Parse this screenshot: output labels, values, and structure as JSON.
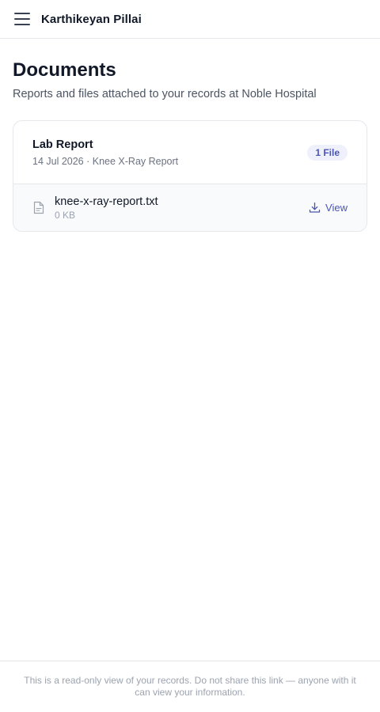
{
  "header": {
    "user_name": "Karthikeyan Pillai",
    "menu_icon": "menu-icon"
  },
  "main": {
    "title": "Documents",
    "subtitle": "Reports and files attached to your records at Noble Hospital",
    "documents": [
      {
        "title": "Lab Report",
        "meta": "14 Jul 2026 · Knee X-Ray Report",
        "file_count": "1 File",
        "files": [
          {
            "name": "knee-x-ray-report.txt",
            "size": "0 KB",
            "icon": "file-text-icon",
            "action_label": "View",
            "action_icon": "download-icon"
          }
        ]
      }
    ]
  },
  "footer": {
    "notice": "This is a read-only view of your records. Do not share this link — anyone with it can view your information."
  },
  "colors": {
    "accent": "#4b55b4",
    "badge_bg": "#eef0fb",
    "border": "#e5e7eb",
    "muted_text": "#6b7280"
  }
}
